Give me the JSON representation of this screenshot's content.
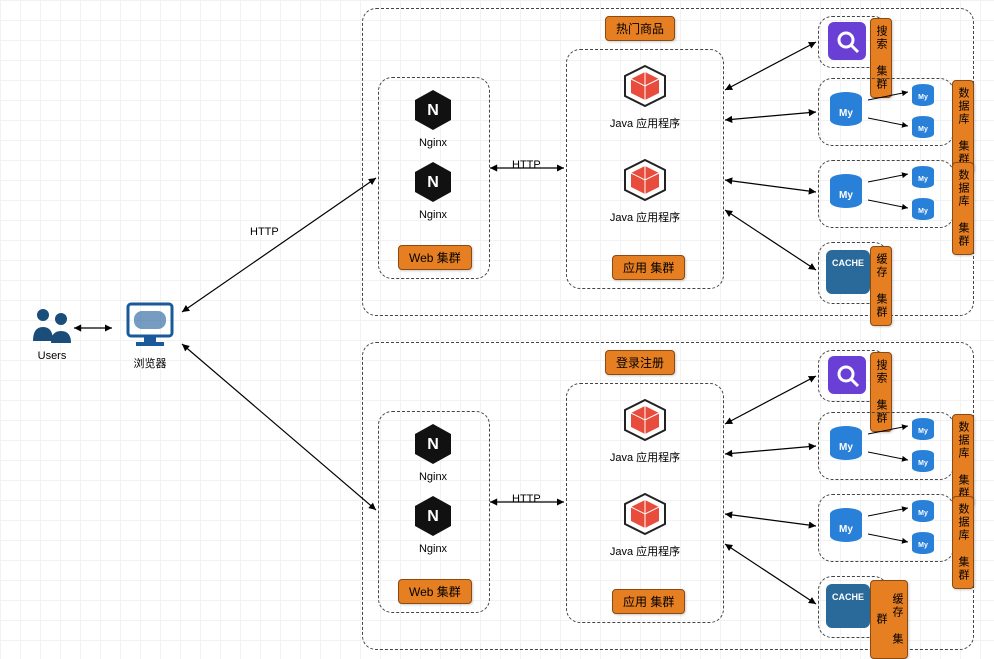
{
  "actors": {
    "users": "Users",
    "browser": "浏览器"
  },
  "edges": {
    "http": "HTTP"
  },
  "clusters": {
    "top": {
      "title": "热门商品",
      "web_cluster": "Web 集群",
      "nginx1": "Nginx",
      "nginx2": "Nginx",
      "app_cluster": "应用 集群",
      "java1": "Java 应用程序",
      "java2": "Java 应用程序",
      "search_cluster": "搜索 集群",
      "db_cluster1": "数据库 集群",
      "db_cluster2": "数据库 集群",
      "cache_cluster": "缓存 集群",
      "cache_label": "CACHE",
      "my_label": "My"
    },
    "bottom": {
      "title": "登录注册",
      "web_cluster": "Web 集群",
      "nginx1": "Nginx",
      "nginx2": "Nginx",
      "app_cluster": "应用 集群",
      "java1": "Java 应用程序",
      "java2": "Java 应用程序",
      "search_cluster": "搜索 集群",
      "db_cluster1": "数据库 集群",
      "db_cluster2": "数据库 集群",
      "cache_cluster": "缓存 集群",
      "cache_label": "CACHE",
      "my_label": "My"
    }
  }
}
